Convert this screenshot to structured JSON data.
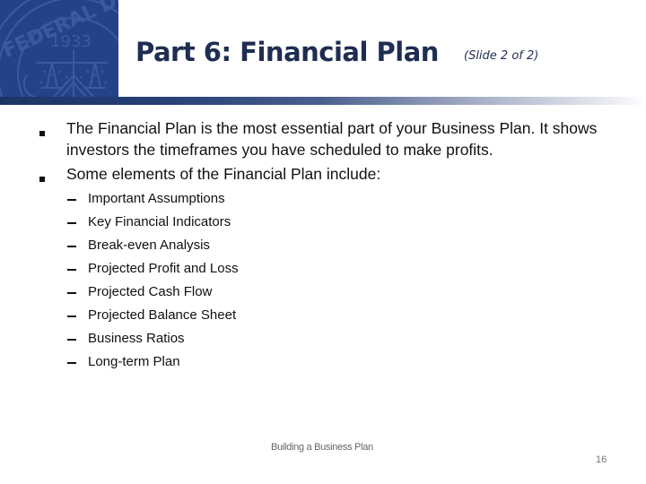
{
  "slide": {
    "title": "Part 6: Financial Plan",
    "subtitle": "(Slide 2 of 2)",
    "logo": {
      "icon": "federal-reserve-seal-icon",
      "seal_text_top": "FEDERAL DEP",
      "seal_year": "1933",
      "panel_color": "#22438a"
    },
    "bullets": [
      {
        "lines": [
          "The Financial Plan is the most essential part of your Business Plan. It shows",
          "investors the timeframes you have scheduled to make profits."
        ]
      },
      {
        "lines": [
          "Some elements of the Financial Plan include:"
        ],
        "sub_items": [
          "Important Assumptions",
          "Key Financial Indicators",
          "Break-even Analysis",
          "Projected Profit and Loss",
          "Projected Cash Flow",
          "Projected Balance Sheet",
          "Business Ratios",
          "Long-term Plan"
        ]
      }
    ],
    "footer": {
      "center_text": "Building a Business Plan",
      "page_number": "16"
    },
    "colors": {
      "title": "#1f2d52",
      "bar_start": "#1d3566",
      "bar_end": "#ffffff"
    }
  }
}
